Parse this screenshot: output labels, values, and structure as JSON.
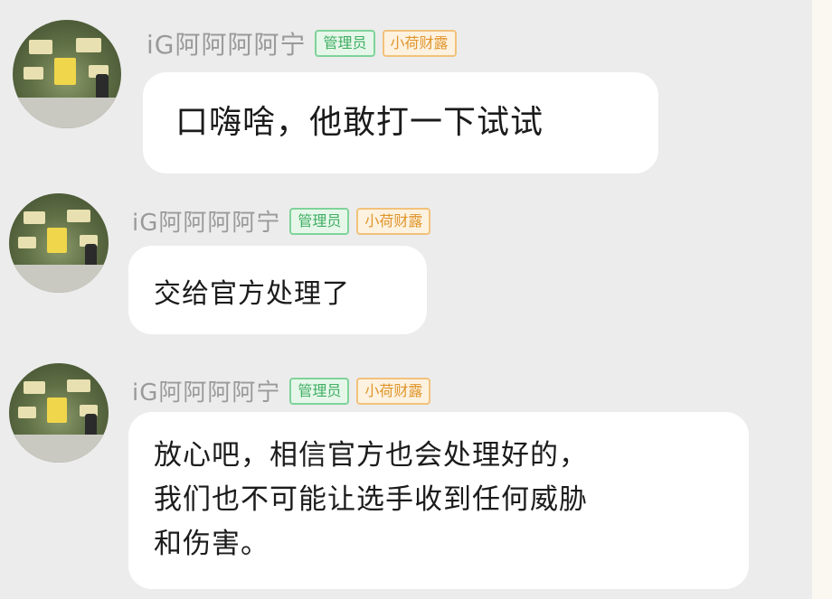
{
  "messages": [
    {
      "sender": "iG阿阿阿阿宁",
      "badges": [
        "管理员",
        "小荷财露"
      ],
      "text": "口嗨啥，他敢打一下试试"
    },
    {
      "sender": "iG阿阿阿阿宁",
      "badges": [
        "管理员",
        "小荷财露"
      ],
      "text": "交给官方处理了"
    },
    {
      "sender": "iG阿阿阿阿宁",
      "badges": [
        "管理员",
        "小荷财露"
      ],
      "text_lines": [
        "放心吧，相信官方也会处理好的，",
        "我们也不可能让选手收到任何威胁",
        "和伤害。"
      ]
    }
  ],
  "colors": {
    "background": "#ececec",
    "bubble": "#ffffff",
    "admin_badge": "#3fae62",
    "title_badge": "#e0952b",
    "username": "#9a9a9a"
  },
  "icons": [
    "avatar-image"
  ]
}
